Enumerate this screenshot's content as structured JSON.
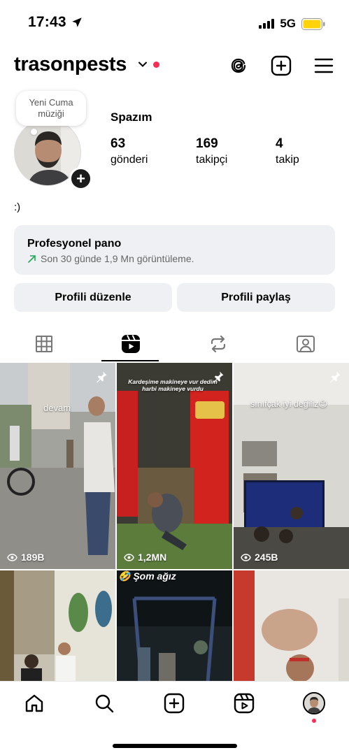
{
  "status_bar": {
    "time": "17:43",
    "network": "5G"
  },
  "header": {
    "username": "trasonpests"
  },
  "profile": {
    "note": "Yeni Cuma müziği",
    "display_name": "Spazım",
    "stats": [
      {
        "value": "63",
        "label": "gönderi"
      },
      {
        "value": "169",
        "label": "takipçi"
      },
      {
        "value": "4",
        "label": "takip"
      }
    ],
    "bio": ":)"
  },
  "dashboard": {
    "title": "Profesyonel pano",
    "subtitle": "Son 30 günde 1,9 Mn görüntüleme."
  },
  "buttons": {
    "edit": "Profili düzenle",
    "share": "Profili paylaş"
  },
  "tabs": [
    "grid-icon",
    "reels-icon",
    "reposts-icon",
    "tagged-icon"
  ],
  "reels": [
    {
      "caption": "devam",
      "views": "189B",
      "pinned": true
    },
    {
      "caption": "Kardeşime makineye vur dedim harbi makineye vurdu",
      "views": "1,2MN",
      "pinned": true
    },
    {
      "caption": "sınıfçak iyi değiliz😊",
      "views": "245B",
      "pinned": true
    },
    {
      "caption": "",
      "views": "",
      "pinned": false
    },
    {
      "caption": "🤣 Şom ağız",
      "views": "",
      "pinned": false
    },
    {
      "caption": "",
      "views": "",
      "pinned": false
    }
  ],
  "colors": {
    "accent_red": "#ff2d55",
    "trend_green": "#1fa855",
    "panel_gray": "#eff0f3"
  }
}
